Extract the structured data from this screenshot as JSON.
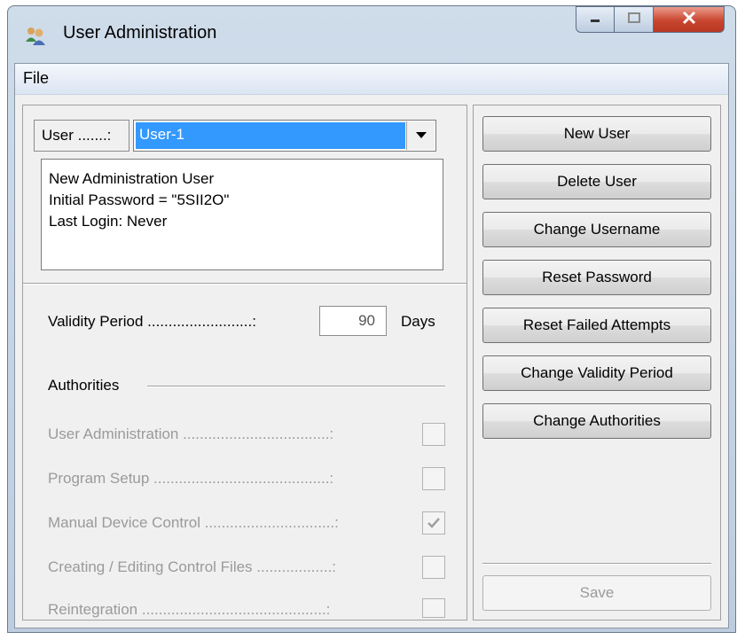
{
  "window": {
    "title": "User Administration",
    "icon": "users-icon",
    "controls": {
      "minimize": "minimize-icon",
      "maximize": "maximize-icon",
      "close": "close-icon"
    }
  },
  "menu": {
    "items": [
      "File"
    ]
  },
  "user": {
    "label": "User .......:",
    "selected": "User-1"
  },
  "info": {
    "lines": [
      "New Administration User",
      "Initial Password = \"5SII2O\"",
      "Last Login: Never"
    ]
  },
  "validity": {
    "label": "Validity Period .........................:",
    "value": "90",
    "unit": "Days"
  },
  "authorities": {
    "heading": "Authorities",
    "items": [
      {
        "label": "User Administration ...................................:",
        "checked": false
      },
      {
        "label": "Program Setup ..........................................:",
        "checked": false
      },
      {
        "label": "Manual Device Control ...............................:",
        "checked": true
      },
      {
        "label": "Creating / Editing Control Files ..................:",
        "checked": false
      },
      {
        "label": "Reintegration ............................................:",
        "checked": false
      }
    ]
  },
  "actions": {
    "buttons": [
      "New User",
      "Delete User",
      "Change Username",
      "Reset Password",
      "Reset Failed Attempts",
      "Change Validity Period",
      "Change Authorities"
    ],
    "save": "Save"
  },
  "colors": {
    "selection": "#3399ff",
    "disabled_text": "#9a9a9a",
    "close_button": "#c9452f"
  }
}
